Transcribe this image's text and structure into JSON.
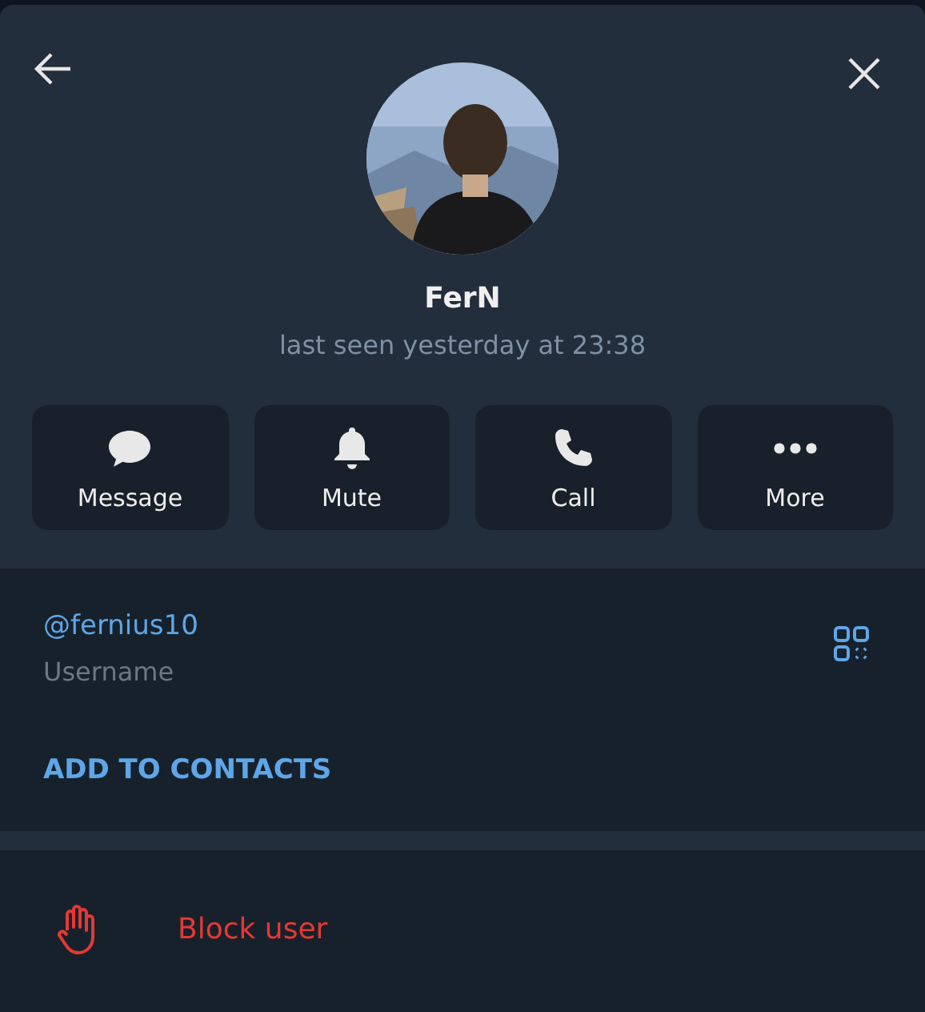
{
  "profile": {
    "name": "FerN",
    "status": "last seen yesterday at 23:38"
  },
  "actions": [
    {
      "kind": "message",
      "label": "Message"
    },
    {
      "kind": "mute",
      "label": "Mute"
    },
    {
      "kind": "call",
      "label": "Call"
    },
    {
      "kind": "more",
      "label": "More"
    }
  ],
  "info": {
    "username": "@fernius10",
    "username_label": "Username",
    "add_contact": "ADD TO CONTACTS"
  },
  "block": {
    "label": "Block user"
  }
}
